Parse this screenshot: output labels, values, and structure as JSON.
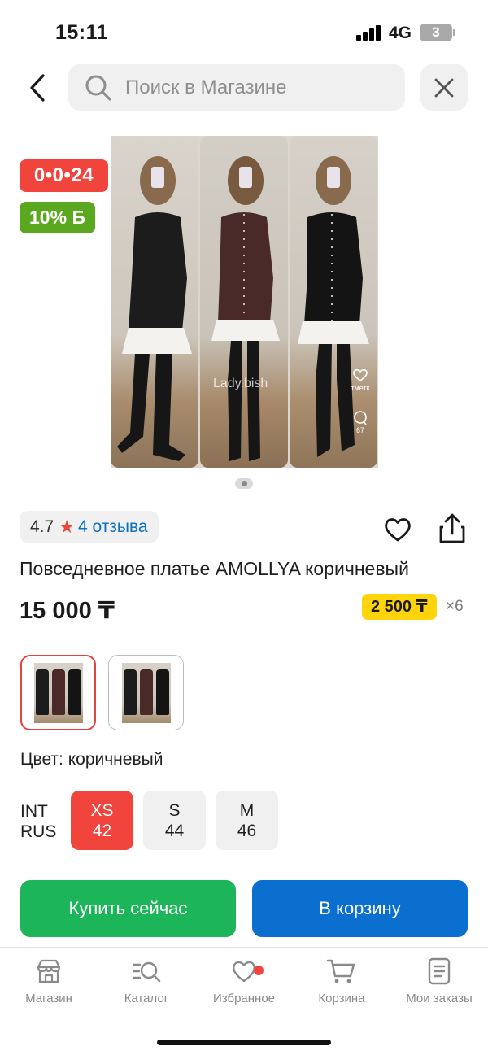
{
  "status_bar": {
    "time": "15:11",
    "network": "4G",
    "battery": "3"
  },
  "header": {
    "search_placeholder": "Поиск в Магазине"
  },
  "badges": {
    "timer": "0•0•24",
    "bonus": "10% Б"
  },
  "image": {
    "watermark": "Lady.bish",
    "side_label": "тметк",
    "side_count": "67"
  },
  "rating": {
    "value": "4.7",
    "reviews": "4 отзыва"
  },
  "product": {
    "title": "Повседневное платье AMOLLYA коричневый",
    "price": "15 000 ₸",
    "installment_price": "2 500 ₸",
    "installment_months": "×6"
  },
  "color": {
    "label": "Цвет: коричневый"
  },
  "sizes": {
    "system_int": "INT",
    "system_rus": "RUS",
    "options": [
      {
        "int": "XS",
        "rus": "42",
        "selected": true
      },
      {
        "int": "S",
        "rus": "44",
        "selected": false
      },
      {
        "int": "M",
        "rus": "46",
        "selected": false
      }
    ]
  },
  "actions": {
    "buy_now": "Купить сейчас",
    "add_to_cart": "В корзину"
  },
  "tabs": [
    {
      "label": "Магазин",
      "icon": "store-icon"
    },
    {
      "label": "Каталог",
      "icon": "catalog-icon"
    },
    {
      "label": "Избранное",
      "icon": "heart-icon",
      "has_dot": true
    },
    {
      "label": "Корзина",
      "icon": "cart-icon"
    },
    {
      "label": "Мои заказы",
      "icon": "orders-icon"
    }
  ],
  "colors": {
    "accent_red": "#f0443d",
    "green": "#1cb55a",
    "blue": "#0b6fd0",
    "yellow": "#ffd40b",
    "bonus_green": "#5aa81d",
    "link_blue": "#0a6fc6"
  }
}
